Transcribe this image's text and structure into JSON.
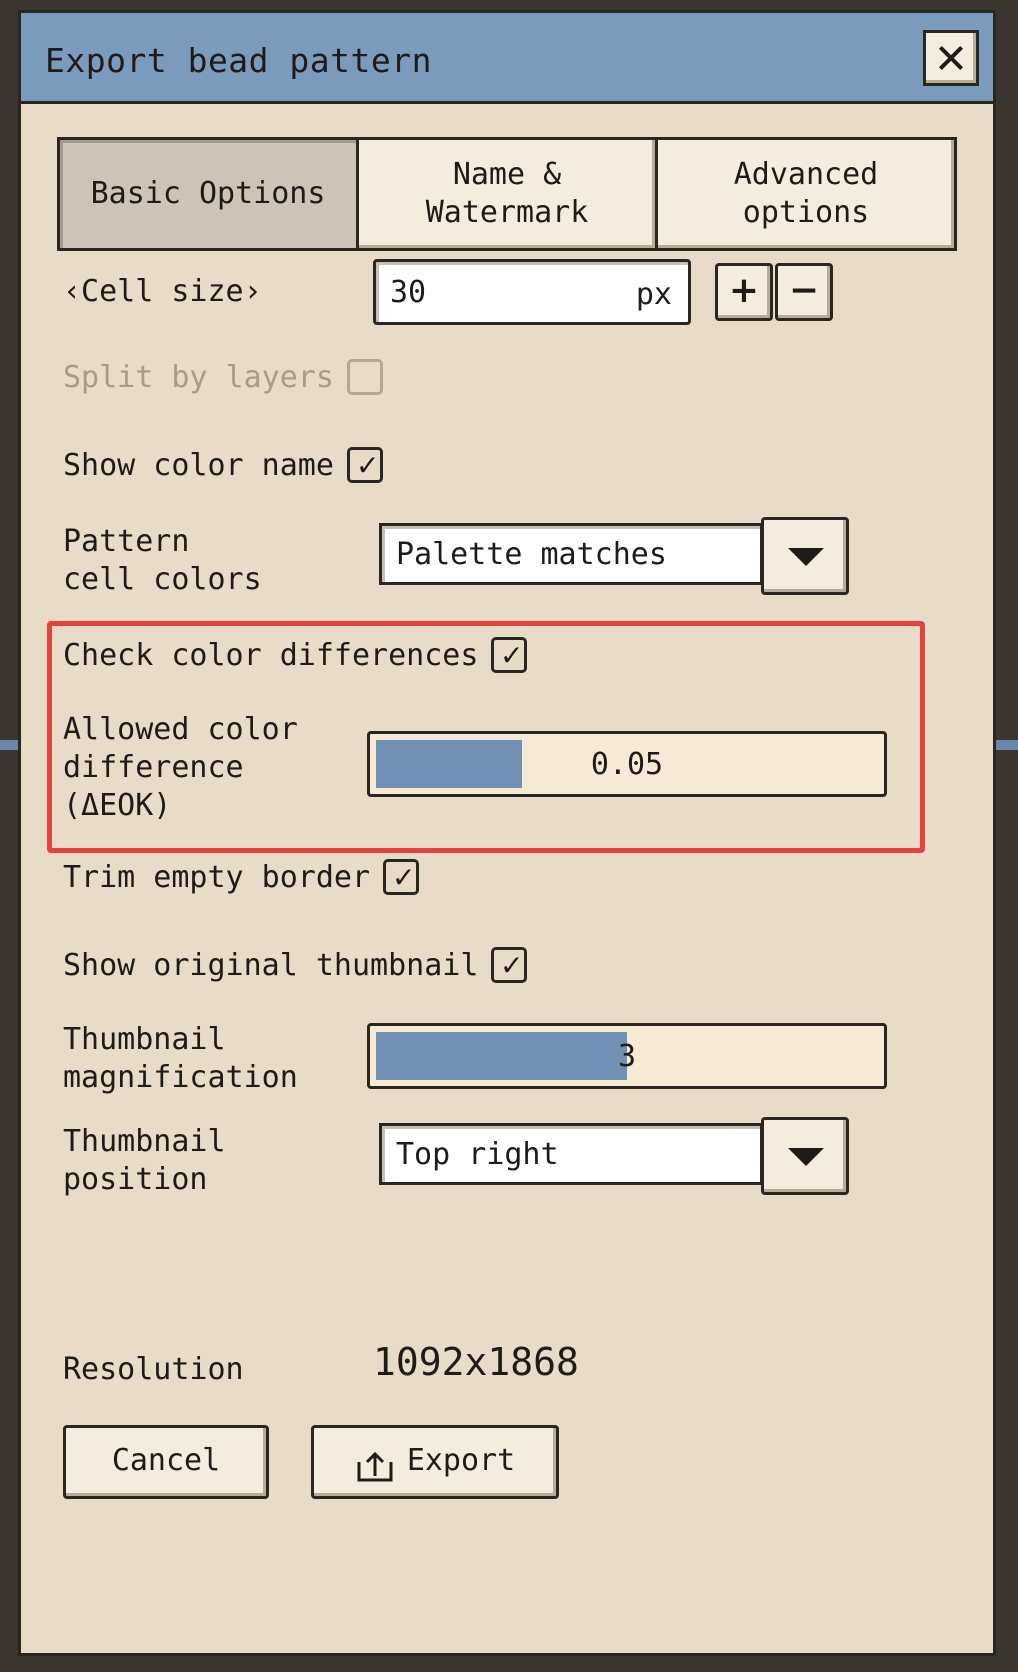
{
  "dialog": {
    "title": "Export bead pattern",
    "close_icon": "close-icon"
  },
  "tabs": [
    {
      "label": "Basic Options",
      "active": true
    },
    {
      "label": "Name &\nWatermark",
      "active": false
    },
    {
      "label": "Advanced\noptions",
      "active": false
    }
  ],
  "cell_size": {
    "label": "‹Cell size›",
    "value": "30",
    "unit": "px",
    "increment_label": "+",
    "decrement_label": "−"
  },
  "split_by_layers": {
    "label": "Split by layers",
    "checked": false,
    "disabled": true
  },
  "show_color_name": {
    "label": "Show color name",
    "checked": true
  },
  "pattern_cell_colors": {
    "label": "Pattern\ncell colors",
    "selected": "Palette matches",
    "dropdown_icon": "chevron-down-icon"
  },
  "check_color_differences": {
    "label": "Check color differences",
    "checked": true
  },
  "allowed_color_difference": {
    "label": "Allowed color\ndifference\n(ΔEOK)",
    "value": "0.05",
    "fill_fraction": 0.29
  },
  "trim_empty_border": {
    "label": "Trim empty border",
    "checked": true
  },
  "show_original_thumbnail": {
    "label": "Show original thumbnail",
    "checked": true
  },
  "thumbnail_magnification": {
    "label": "Thumbnail\nmagnification",
    "value": "3",
    "fill_fraction": 0.5
  },
  "thumbnail_position": {
    "label": "Thumbnail\nposition",
    "selected": "Top right",
    "dropdown_icon": "chevron-down-icon"
  },
  "resolution": {
    "label": "Resolution",
    "value": "1092x1868"
  },
  "actions": {
    "cancel_label": "Cancel",
    "export_label": "Export",
    "export_icon": "export-icon"
  },
  "colors": {
    "titlebar": "#7b9bbd",
    "dialog_bg": "#e8dcc8",
    "slider_fill": "#7090b4",
    "highlight": "#e8403f"
  }
}
